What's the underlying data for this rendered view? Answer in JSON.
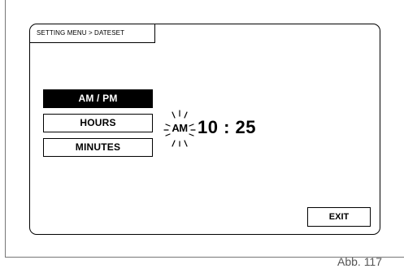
{
  "breadcrumb": "SETTING MENU > DATESET",
  "menu": {
    "items": [
      {
        "label": "AM / PM",
        "selected": true
      },
      {
        "label": "HOURS",
        "selected": false
      },
      {
        "label": "MINUTES",
        "selected": false
      }
    ]
  },
  "display": {
    "ampm": "AM",
    "time": "10 : 25",
    "ampm_blinking": true
  },
  "exit_label": "EXIT",
  "caption": "Abb. 117",
  "colors": {
    "selected_bg": "#000000",
    "selected_fg": "#ffffff"
  },
  "icons": {
    "blink_rays": "blink-rays-icon"
  }
}
